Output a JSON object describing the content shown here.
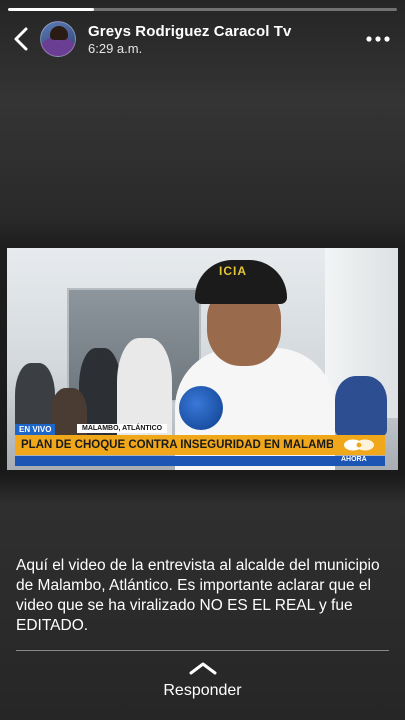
{
  "story": {
    "progress": 0.22
  },
  "header": {
    "author_name": "Greys Rodriguez Caracol Tv",
    "timestamp": "6:29 a.m."
  },
  "video": {
    "cap_text": "ICIA",
    "live_label": "EN VIVO",
    "location": "MALAMBO, ATLÁNTICO",
    "headline": "PLAN DE CHOQUE CONTRA INSEGURIDAD EN MALAMBO",
    "ticker_right": "AHORA"
  },
  "caption": {
    "text": "Aquí el video de la entrevista al alcalde del municipio de Malambo, Atlántico. Es importante aclarar que el video que se ha viralizado NO ES EL REAL y fue EDITADO."
  },
  "footer": {
    "reply_label": "Responder"
  },
  "icons": {
    "back": "chevron-left-icon",
    "more": "more-horizontal-icon",
    "reply": "chevron-up-icon"
  }
}
